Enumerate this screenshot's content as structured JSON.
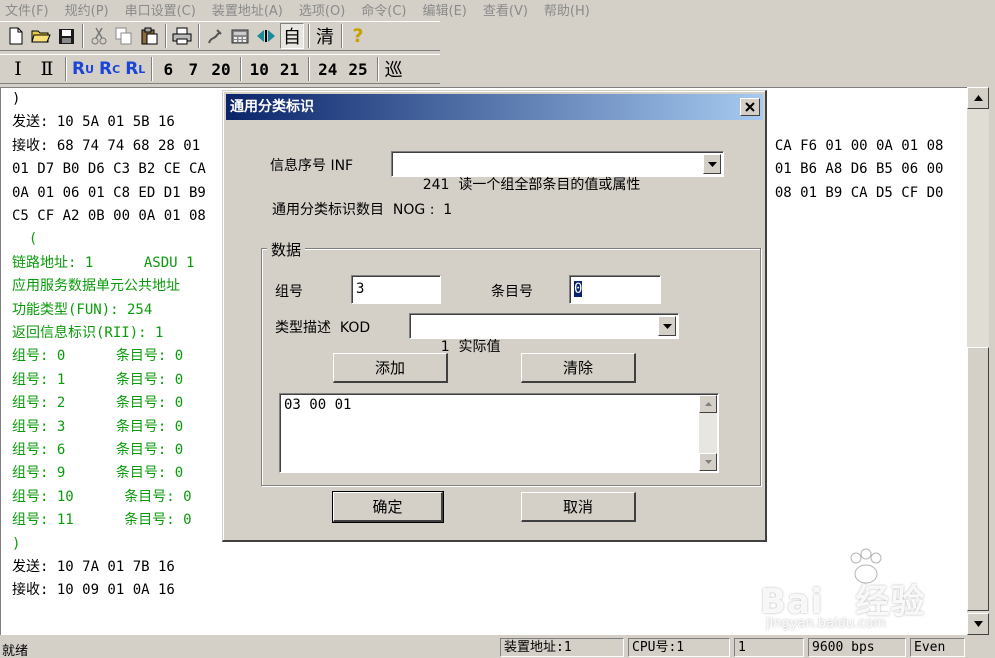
{
  "menubar": {
    "items": [
      "文件(F)",
      "规约(P)",
      "串口设置(C)",
      "装置地址(A)",
      "选项(O)",
      "命令(C)",
      "编辑(E)",
      "查看(V)",
      "帮助(H)"
    ]
  },
  "toolbar1": {
    "auto": "自",
    "clear": "清",
    "help_icon": "?"
  },
  "toolbar2": {
    "roman1": "Ⅰ",
    "roman2": "Ⅱ",
    "ru": "R",
    "ru_sub": "U",
    "rc": "R",
    "rc_sub": "C",
    "rl": "R",
    "rl_sub": "L",
    "b6": "6",
    "b7": "7",
    "b20": "20",
    "b10": "10",
    "b21": "21",
    "b24": "24",
    "b25": "25",
    "patrol": "巡"
  },
  "output": {
    "lines": [
      {
        "text": ")",
        "green": false
      },
      {
        "text": "发送: 10 5A 01 5B 16",
        "green": false
      },
      {
        "text": "接收: 68 74 74 68 28 01",
        "green": false
      },
      {
        "text": "01 D7 B0 D6 C3 B2 CE CA",
        "green": false
      },
      {
        "text": "0A 01 06 01 C8 ED D1 B9",
        "green": false
      },
      {
        "text": "C5 CF A2 0B 00 0A 01 08",
        "green": false
      },
      {
        "text": "  (",
        "green": true
      },
      {
        "text": "链路地址: 1      ASDU 1",
        "green": true
      },
      {
        "text": "应用服务数据单元公共地址",
        "green": true
      },
      {
        "text": "功能类型(FUN): 254",
        "green": true
      },
      {
        "text": "返回信息标识(RII): 1",
        "green": true
      },
      {
        "text": "组号: 0      条目号: 0",
        "green": true
      },
      {
        "text": "组号: 1      条目号: 0",
        "green": true
      },
      {
        "text": "组号: 2      条目号: 0",
        "green": true
      },
      {
        "text": "组号: 3      条目号: 0",
        "green": true
      },
      {
        "text": "组号: 6      条目号: 0",
        "green": true
      },
      {
        "text": "组号: 9      条目号: 0",
        "green": true
      },
      {
        "text": "组号: 10      条目号: 0",
        "green": true
      },
      {
        "text": "组号: 11      条目号: 0",
        "green": true
      },
      {
        "text": ")",
        "green": true
      },
      {
        "text": "发送: 10 7A 01 7B 16",
        "green": false
      },
      {
        "text": "接收: 10 09 01 0A 16",
        "green": false
      }
    ],
    "right_lines": [
      "3 CA F6 01 00 0A 01 08",
      "4 01 B6 A8 D6 B5 06 00",
      "1 08 01 B9 CA D5 CF D0"
    ]
  },
  "dialog": {
    "title": "通用分类标识",
    "inf_label": "信息序号 INF",
    "inf_value": "241  读一个组全部条目的值或属性",
    "nog_label": "通用分类标识数目  NOG :  1",
    "group_title": "数据",
    "group_no_label": "组号",
    "group_no_value": "3",
    "entry_no_label": "条目号",
    "entry_no_value": "0",
    "kod_label": "类型描述  KOD",
    "kod_value": "1  实际值",
    "add_button": "添加",
    "clear_button": "清除",
    "list_value": "03 00 01",
    "ok_button": "确定",
    "cancel_button": "取消"
  },
  "statusbar": {
    "ready": "就绪",
    "device_addr": "装置地址:1",
    "cpu": "CPU号:1",
    "field3": "1",
    "baud": "9600 bps",
    "parity": "Even"
  },
  "watermark": {
    "brand": "Bai",
    "brand2": "经验",
    "url": "jingyan.baidu.com"
  }
}
